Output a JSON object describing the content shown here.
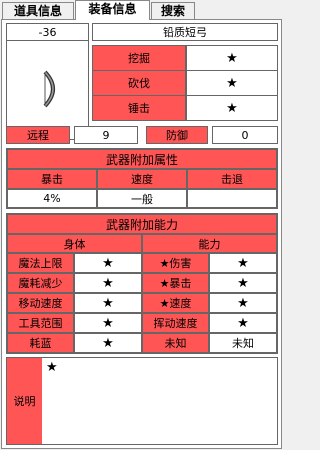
{
  "tabs": [
    {
      "label": "道具信息",
      "active": false
    },
    {
      "label": "装备信息",
      "active": true
    },
    {
      "label": "搜索",
      "active": false
    }
  ],
  "item": {
    "id": "-36",
    "name": "铅质短弓",
    "icon": "bow-icon"
  },
  "tool_power": [
    {
      "label": "挖掘",
      "value": "★"
    },
    {
      "label": "砍伐",
      "value": "★"
    },
    {
      "label": "锤击",
      "value": "★"
    }
  ],
  "stats": {
    "ranged_label": "远程",
    "ranged_value": "9",
    "defense_label": "防御",
    "defense_value": "0"
  },
  "weapon_attr": {
    "title": "武器附加属性",
    "headers": [
      "暴击",
      "速度",
      "击退"
    ],
    "values": [
      "4%",
      "一般",
      ""
    ]
  },
  "weapon_ability": {
    "title": "武器附加能力",
    "col1": "身体",
    "col2": "能力",
    "rows": [
      {
        "a": "魔法上限",
        "av": "★",
        "b": "★伤害",
        "bv": "★"
      },
      {
        "a": "魔耗减少",
        "av": "★",
        "b": "★暴击",
        "bv": "★"
      },
      {
        "a": "移动速度",
        "av": "★",
        "b": "★速度",
        "bv": "★"
      },
      {
        "a": "工具范围",
        "av": "★",
        "b": "挥动速度",
        "bv": "★"
      },
      {
        "a": "耗蓝",
        "av": "★",
        "b": "未知",
        "bv": "未知"
      }
    ]
  },
  "description": {
    "label": "说明",
    "text": "★"
  },
  "colors": {
    "accent": "#ff5555"
  }
}
